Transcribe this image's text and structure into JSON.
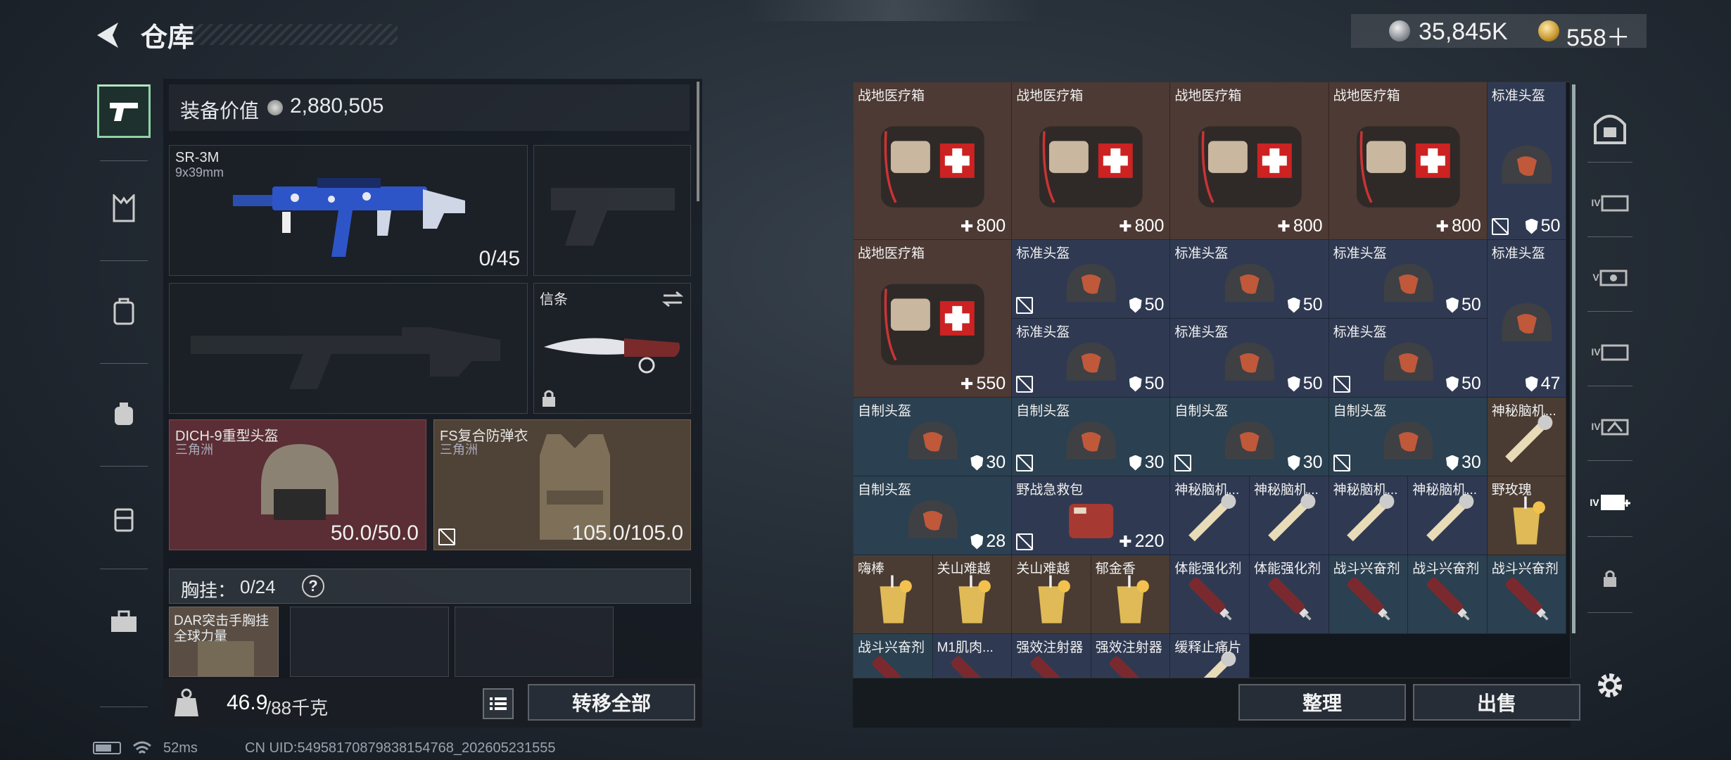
{
  "header": {
    "title": "仓库",
    "currency_main": "35,845K",
    "currency_premium": "558＋"
  },
  "equipment": {
    "value_label": "装备价值",
    "value": "2,880,505",
    "primary": {
      "name": "SR-3M",
      "caliber": "9x39mm",
      "ammo": "0/45"
    },
    "melee": {
      "name": "信条"
    },
    "helmet": {
      "name": "DICH-9重型头盔",
      "faction": "三角洲",
      "durability": "50.0/50.0"
    },
    "armor": {
      "name": "FS复合防弹衣",
      "faction": "三角洲",
      "durability": "105.0/105.0"
    },
    "chest": {
      "label": "胸挂：",
      "count": "0/24",
      "help": "?",
      "item_name": "DAR突击手胸挂",
      "item_sub": "全球力量"
    }
  },
  "weight": {
    "current": "46.9",
    "max": "/88千克"
  },
  "buttons": {
    "transfer_all": "转移全部",
    "sort": "整理",
    "sell": "出售"
  },
  "stash": [
    {
      "name": "战地医疗箱",
      "value": "800",
      "type": "med",
      "x": 0,
      "y": 0,
      "w": 2,
      "h": 2,
      "color": "red"
    },
    {
      "name": "战地医疗箱",
      "value": "800",
      "type": "med",
      "x": 2,
      "y": 0,
      "w": 2,
      "h": 2,
      "color": "red"
    },
    {
      "name": "战地医疗箱",
      "value": "800",
      "type": "med",
      "x": 4,
      "y": 0,
      "w": 2,
      "h": 2,
      "color": "red"
    },
    {
      "name": "战地医疗箱",
      "value": "800",
      "type": "med",
      "x": 6,
      "y": 0,
      "w": 2,
      "h": 2,
      "color": "red"
    },
    {
      "name": "标准头盔",
      "value": "50",
      "type": "armor",
      "x": 8,
      "y": 0,
      "w": 1,
      "h": 2,
      "color": "blue",
      "nodur": true
    },
    {
      "name": "战地医疗箱",
      "value": "550",
      "type": "med",
      "x": 0,
      "y": 2,
      "w": 2,
      "h": 2,
      "color": "red"
    },
    {
      "name": "标准头盔",
      "value": "50",
      "type": "armor",
      "x": 2,
      "y": 2,
      "w": 2,
      "h": 1,
      "color": "blue",
      "nodur": true
    },
    {
      "name": "标准头盔",
      "value": "50",
      "type": "armor",
      "x": 4,
      "y": 2,
      "w": 2,
      "h": 1,
      "color": "blue"
    },
    {
      "name": "标准头盔",
      "value": "50",
      "type": "armor",
      "x": 6,
      "y": 2,
      "w": 2,
      "h": 1,
      "color": "blue"
    },
    {
      "name": "标准头盔",
      "value": "47",
      "type": "armor",
      "x": 8,
      "y": 2,
      "w": 1,
      "h": 2,
      "color": "blue"
    },
    {
      "name": "标准头盔",
      "value": "50",
      "type": "armor",
      "x": 2,
      "y": 3,
      "w": 2,
      "h": 1,
      "color": "blue",
      "nodur": true
    },
    {
      "name": "标准头盔",
      "value": "50",
      "type": "armor",
      "x": 4,
      "y": 3,
      "w": 2,
      "h": 1,
      "color": "blue"
    },
    {
      "name": "标准头盔",
      "value": "50",
      "type": "armor",
      "x": 6,
      "y": 3,
      "w": 2,
      "h": 1,
      "color": "blue",
      "nodur": true
    },
    {
      "name": "自制头盔",
      "value": "30",
      "type": "armor",
      "x": 0,
      "y": 4,
      "w": 2,
      "h": 1,
      "color": "teal"
    },
    {
      "name": "自制头盔",
      "value": "30",
      "type": "armor",
      "x": 2,
      "y": 4,
      "w": 2,
      "h": 1,
      "color": "teal",
      "nodur": true
    },
    {
      "name": "自制头盔",
      "value": "30",
      "type": "armor",
      "x": 4,
      "y": 4,
      "w": 2,
      "h": 1,
      "color": "teal",
      "nodur": true
    },
    {
      "name": "自制头盔",
      "value": "30",
      "type": "armor",
      "x": 6,
      "y": 4,
      "w": 2,
      "h": 1,
      "color": "teal",
      "nodur": true
    },
    {
      "name": "神秘脑机...",
      "value": "",
      "type": "misc",
      "x": 8,
      "y": 4,
      "w": 1,
      "h": 1,
      "color": "brown"
    },
    {
      "name": "自制头盔",
      "value": "28",
      "type": "armor",
      "x": 0,
      "y": 5,
      "w": 2,
      "h": 1,
      "color": "teal"
    },
    {
      "name": "野战急救包",
      "value": "220",
      "type": "med",
      "x": 2,
      "y": 5,
      "w": 2,
      "h": 1,
      "color": "blue",
      "nodur": true
    },
    {
      "name": "神秘脑机...",
      "value": "",
      "type": "misc",
      "x": 4,
      "y": 5,
      "w": 1,
      "h": 1,
      "color": "blue"
    },
    {
      "name": "神秘脑机...",
      "value": "",
      "type": "misc",
      "x": 5,
      "y": 5,
      "w": 1,
      "h": 1,
      "color": "blue"
    },
    {
      "name": "神秘脑机...",
      "value": "",
      "type": "misc",
      "x": 6,
      "y": 5,
      "w": 1,
      "h": 1,
      "color": "blue"
    },
    {
      "name": "神秘脑机...",
      "value": "",
      "type": "misc",
      "x": 7,
      "y": 5,
      "w": 1,
      "h": 1,
      "color": "blue"
    },
    {
      "name": "野玫瑰",
      "value": "",
      "type": "drink",
      "x": 8,
      "y": 5,
      "w": 1,
      "h": 1,
      "color": "brown"
    },
    {
      "name": "嗨棒",
      "value": "",
      "type": "drink",
      "x": 0,
      "y": 6,
      "w": 1,
      "h": 1,
      "color": "brown"
    },
    {
      "name": "关山难越",
      "value": "",
      "type": "drink",
      "x": 1,
      "y": 6,
      "w": 1,
      "h": 1,
      "color": "brown"
    },
    {
      "name": "关山难越",
      "value": "",
      "type": "drink",
      "x": 2,
      "y": 6,
      "w": 1,
      "h": 1,
      "color": "brown"
    },
    {
      "name": "郁金香",
      "value": "",
      "type": "drink",
      "x": 3,
      "y": 6,
      "w": 1,
      "h": 1,
      "color": "brown"
    },
    {
      "name": "体能强化剂",
      "value": "",
      "type": "syringe",
      "x": 4,
      "y": 6,
      "w": 1,
      "h": 1,
      "color": "blue"
    },
    {
      "name": "体能强化剂",
      "value": "",
      "type": "syringe",
      "x": 5,
      "y": 6,
      "w": 1,
      "h": 1,
      "color": "blue"
    },
    {
      "name": "战斗兴奋剂",
      "value": "",
      "type": "syringe",
      "x": 6,
      "y": 6,
      "w": 1,
      "h": 1,
      "color": "teal"
    },
    {
      "name": "战斗兴奋剂",
      "value": "",
      "type": "syringe",
      "x": 7,
      "y": 6,
      "w": 1,
      "h": 1,
      "color": "teal"
    },
    {
      "name": "战斗兴奋剂",
      "value": "",
      "type": "syringe",
      "x": 8,
      "y": 6,
      "w": 1,
      "h": 1,
      "color": "teal"
    },
    {
      "name": "战斗兴奋剂",
      "value": "",
      "type": "syringe",
      "x": 0,
      "y": 7,
      "w": 1,
      "h": 1,
      "color": "teal"
    },
    {
      "name": "M1肌肉...",
      "value": "",
      "type": "syringe",
      "x": 1,
      "y": 7,
      "w": 1,
      "h": 1,
      "color": "blue"
    },
    {
      "name": "强效注射器",
      "value": "",
      "type": "syringe",
      "x": 2,
      "y": 7,
      "w": 1,
      "h": 1,
      "color": "blue"
    },
    {
      "name": "强效注射器",
      "value": "",
      "type": "syringe",
      "x": 3,
      "y": 7,
      "w": 1,
      "h": 1,
      "color": "blue"
    },
    {
      "name": "缓释止痛片",
      "value": "",
      "type": "misc",
      "x": 4,
      "y": 7,
      "w": 1,
      "h": 1,
      "color": "blue"
    }
  ],
  "status": {
    "ping": "52ms",
    "uid": "CN UID:5495817087983815476​8_202605231555"
  },
  "right_tabs": [
    "IV",
    "V",
    "IV",
    "IV",
    "IV"
  ]
}
